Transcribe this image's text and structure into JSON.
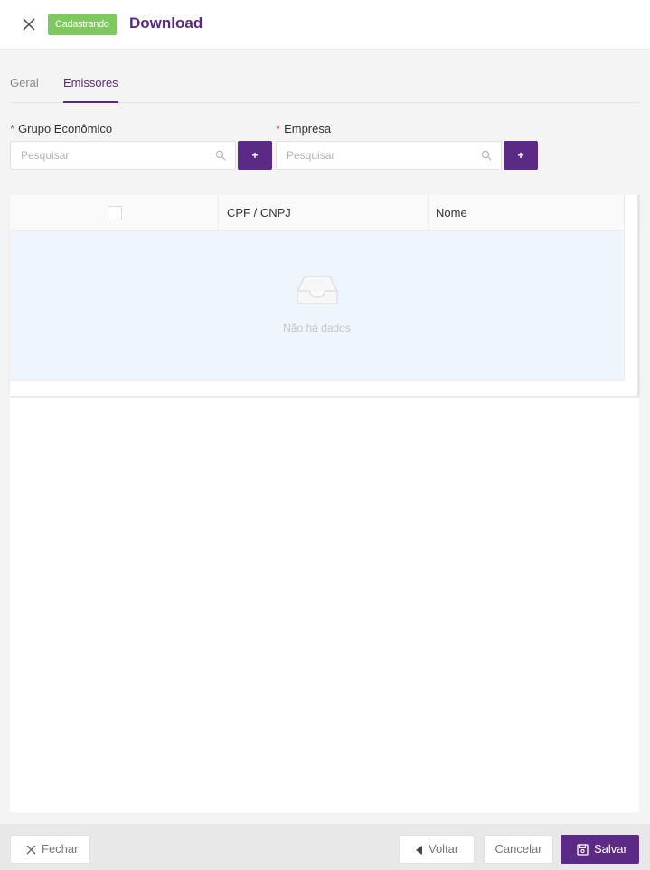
{
  "header": {
    "status_badge": "Cadastrando",
    "title": "Download",
    "close_icon": "close-icon"
  },
  "tabs": [
    {
      "label": "Geral",
      "active": false
    },
    {
      "label": "Emissores",
      "active": true
    }
  ],
  "fields": {
    "grupo": {
      "label": "Grupo Econômico",
      "required_mark": "*",
      "placeholder": "Pesquisar",
      "value": "",
      "add_label": "+"
    },
    "empresa": {
      "label": "Empresa",
      "required_mark": "*",
      "placeholder": "Pesquisar",
      "value": "",
      "add_label": "+"
    }
  },
  "table": {
    "columns": [
      "",
      "CPF / CNPJ",
      "Nome"
    ],
    "rows": [],
    "empty_text": "Não há dados"
  },
  "footer": {
    "fechar_label": "Fechar",
    "voltar_label": "Voltar",
    "cancelar_label": "Cancelar",
    "salvar_label": "Salvar"
  },
  "colors": {
    "primary": "#5b2a86",
    "badge": "#7dc95e",
    "required": "#e0443a"
  }
}
